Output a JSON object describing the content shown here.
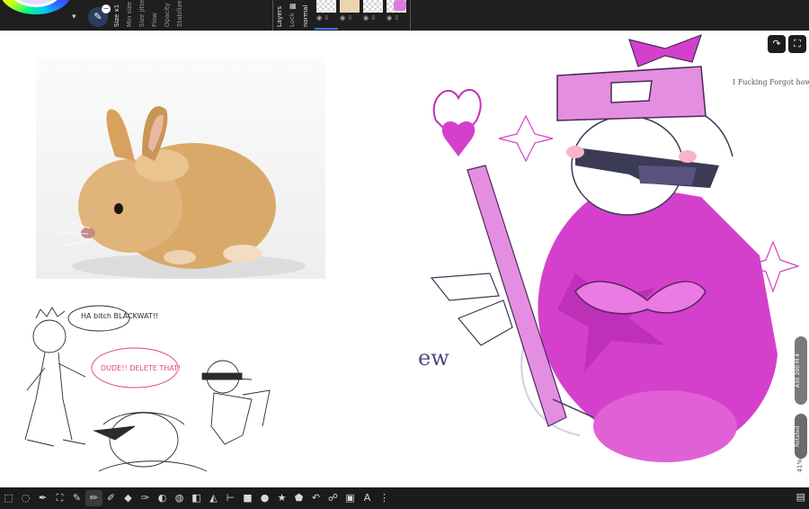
{
  "brush": {
    "props": [
      "Size x1",
      "Min size",
      "Size jitter",
      "Flow",
      "Opacity",
      "Stabilizer"
    ]
  },
  "layers_panel": {
    "labels": [
      "Layers",
      "Lock",
      "normal"
    ]
  },
  "canvas": {
    "sketch_texts": {
      "speech1": "HA bitch BLACKWAT!!",
      "speech2": "DUDE!! DELETE THAT!",
      "note": "I Fucking Forgot how to Draw him",
      "ew": "ew"
    }
  },
  "right_panel": {
    "pill1": "A35 200 M 4",
    "pill2": "Rotated",
    "zoom": "41%"
  },
  "toolbar": {
    "tools": [
      {
        "name": "select-ellipse-icon",
        "glyph": "⬚"
      },
      {
        "name": "lasso-icon",
        "glyph": "◌"
      },
      {
        "name": "pen-curve-icon",
        "glyph": "✒"
      },
      {
        "name": "transform-icon",
        "glyph": "⛶"
      },
      {
        "name": "eyedropper-icon",
        "glyph": "✎"
      },
      {
        "name": "brush-icon",
        "glyph": "✏"
      },
      {
        "name": "pencil-icon",
        "glyph": "✐"
      },
      {
        "name": "fill-icon",
        "glyph": "◆"
      },
      {
        "name": "airbrush-icon",
        "glyph": "✑"
      },
      {
        "name": "smudge-icon",
        "glyph": "◐"
      },
      {
        "name": "blur-icon",
        "glyph": "◍"
      },
      {
        "name": "eraser-icon",
        "glyph": "◧"
      },
      {
        "name": "gradient-icon",
        "glyph": "◭"
      },
      {
        "name": "line-icon",
        "glyph": "⊢"
      },
      {
        "name": "rectangle-icon",
        "glyph": "■"
      },
      {
        "name": "ellipse-icon",
        "glyph": "●"
      },
      {
        "name": "star-icon",
        "glyph": "★"
      },
      {
        "name": "shape-icon",
        "glyph": "⬟"
      },
      {
        "name": "undo-shape-icon",
        "glyph": "↶"
      },
      {
        "name": "knot-icon",
        "glyph": "☍"
      },
      {
        "name": "layer-icon",
        "glyph": "▣"
      },
      {
        "name": "text-icon",
        "glyph": "A"
      },
      {
        "name": "more-icon",
        "glyph": "⋮"
      }
    ],
    "active_index": 5
  }
}
